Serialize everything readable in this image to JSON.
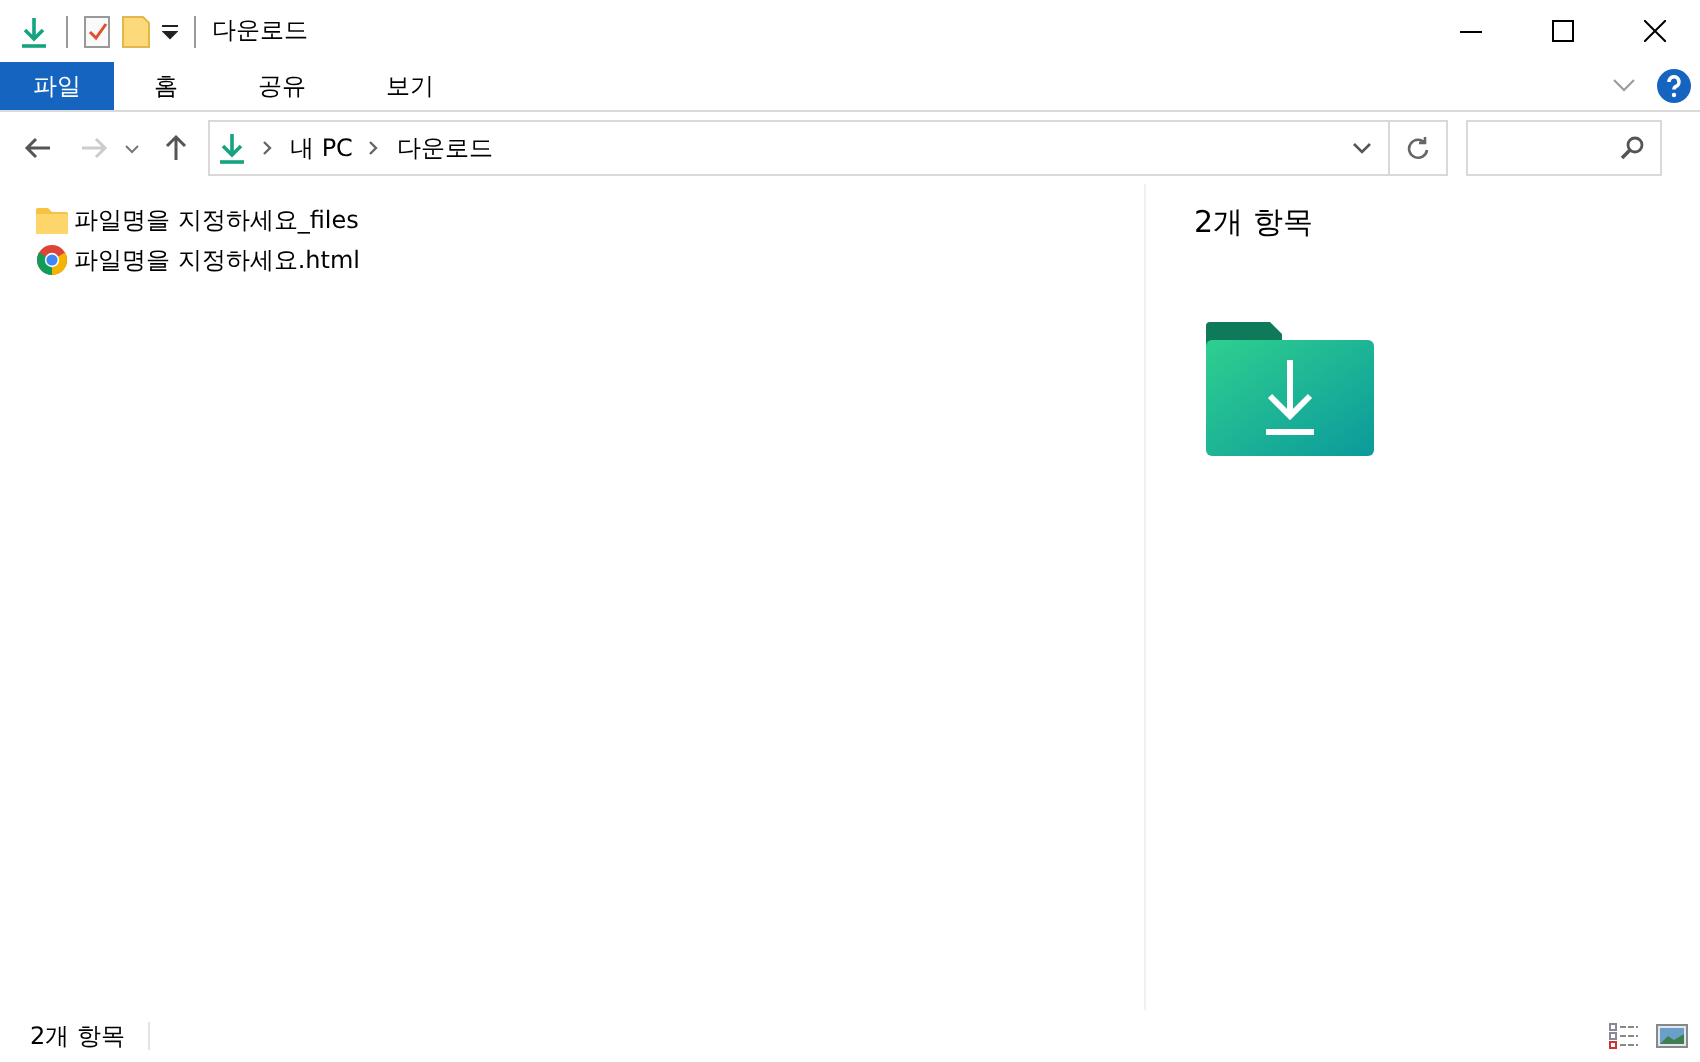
{
  "window": {
    "title": "다운로드"
  },
  "ribbon_tabs": [
    {
      "label": "파일",
      "kind": "file"
    },
    {
      "label": "홈",
      "kind": "tab"
    },
    {
      "label": "공유",
      "kind": "tab"
    },
    {
      "label": "보기",
      "kind": "tab"
    }
  ],
  "address_bar": {
    "path": [
      "내 PC",
      "다운로드"
    ]
  },
  "files": [
    {
      "name": "파일명을 지정하세요_files",
      "kind": "folder"
    },
    {
      "name": "파일명을 지정하세요.html",
      "kind": "chrome"
    }
  ],
  "details_pane": {
    "count": "2개 항목"
  },
  "status_bar": {
    "count": "2개 항목"
  }
}
